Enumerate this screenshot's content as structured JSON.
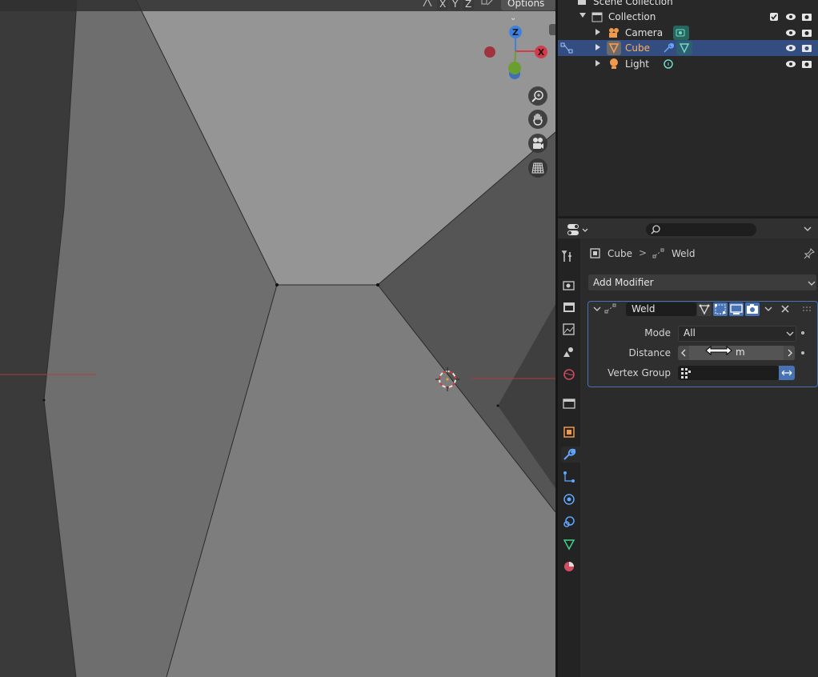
{
  "viewport": {
    "header": {
      "axis_x": "X",
      "axis_y": "Y",
      "axis_z": "Z",
      "options_label": "Options"
    },
    "gizmo": {
      "z_label": "Z",
      "x_label": "X"
    }
  },
  "outliner": {
    "scene_collection": "Scene Collection",
    "collection": "Collection",
    "items": [
      {
        "label": "Camera",
        "selected": false
      },
      {
        "label": "Cube",
        "selected": true
      },
      {
        "label": "Light",
        "selected": false
      }
    ]
  },
  "properties": {
    "breadcrumb": {
      "object": "Cube",
      "separator": ">",
      "modifier": "Weld"
    },
    "add_modifier_label": "Add Modifier",
    "modifier": {
      "name": "Weld",
      "mode_label": "Mode",
      "mode_value": "All",
      "distance_label": "Distance",
      "distance_value": "m",
      "vertex_group_label": "Vertex Group"
    }
  },
  "colors": {
    "accent": "#4772b3",
    "selected_row": "#334d80",
    "cube_label": "#ffb05a",
    "modifier_active_tab": "#5fa6ff"
  }
}
